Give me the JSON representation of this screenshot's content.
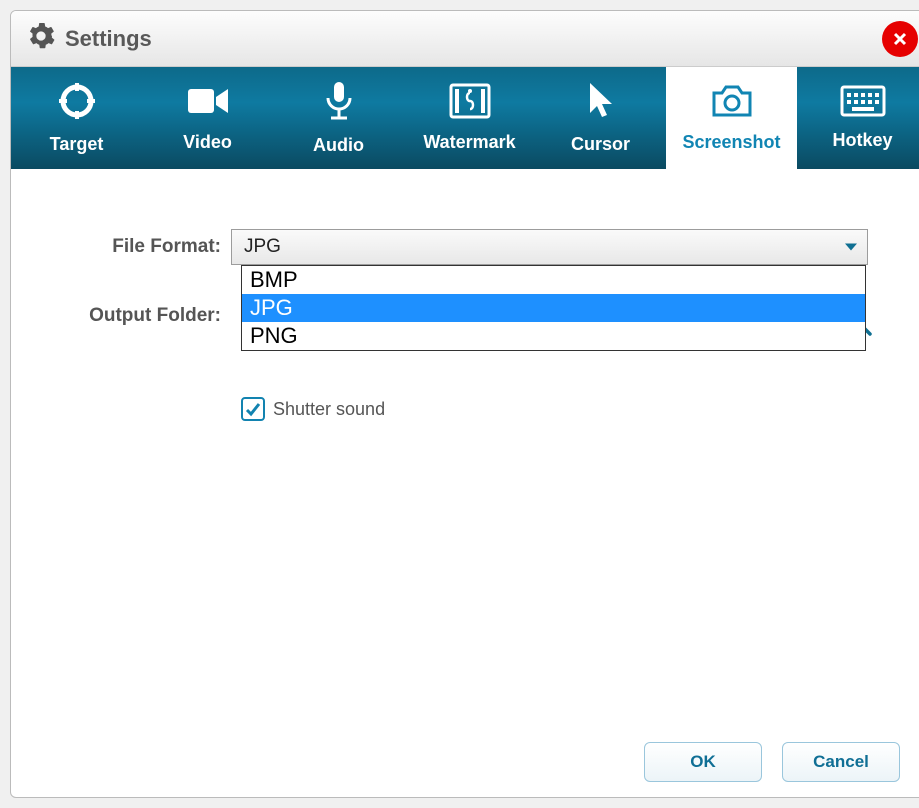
{
  "window": {
    "title": "Settings"
  },
  "tabs": [
    {
      "id": "target",
      "label": "Target",
      "icon": "target-icon",
      "active": false
    },
    {
      "id": "video",
      "label": "Video",
      "icon": "video-icon",
      "active": false
    },
    {
      "id": "audio",
      "label": "Audio",
      "icon": "mic-icon",
      "active": false
    },
    {
      "id": "watermark",
      "label": "Watermark",
      "icon": "watermark-icon",
      "active": false
    },
    {
      "id": "cursor",
      "label": "Cursor",
      "icon": "cursor-icon",
      "active": false
    },
    {
      "id": "screenshot",
      "label": "Screenshot",
      "icon": "camera-icon",
      "active": true
    },
    {
      "id": "hotkey",
      "label": "Hotkey",
      "icon": "keyboard-icon",
      "active": false
    }
  ],
  "form": {
    "file_format_label": "File Format:",
    "file_format_selected": "JPG",
    "file_format_options": [
      "BMP",
      "JPG",
      "PNG"
    ],
    "file_format_highlight": "JPG",
    "output_folder_label": "Output Folder:",
    "shutter_sound_label": "Shutter sound",
    "shutter_sound_checked": true
  },
  "footer": {
    "ok_label": "OK",
    "cancel_label": "Cancel"
  },
  "colors": {
    "accent": "#1185b3",
    "close": "#e60000",
    "highlight": "#1e90ff"
  }
}
